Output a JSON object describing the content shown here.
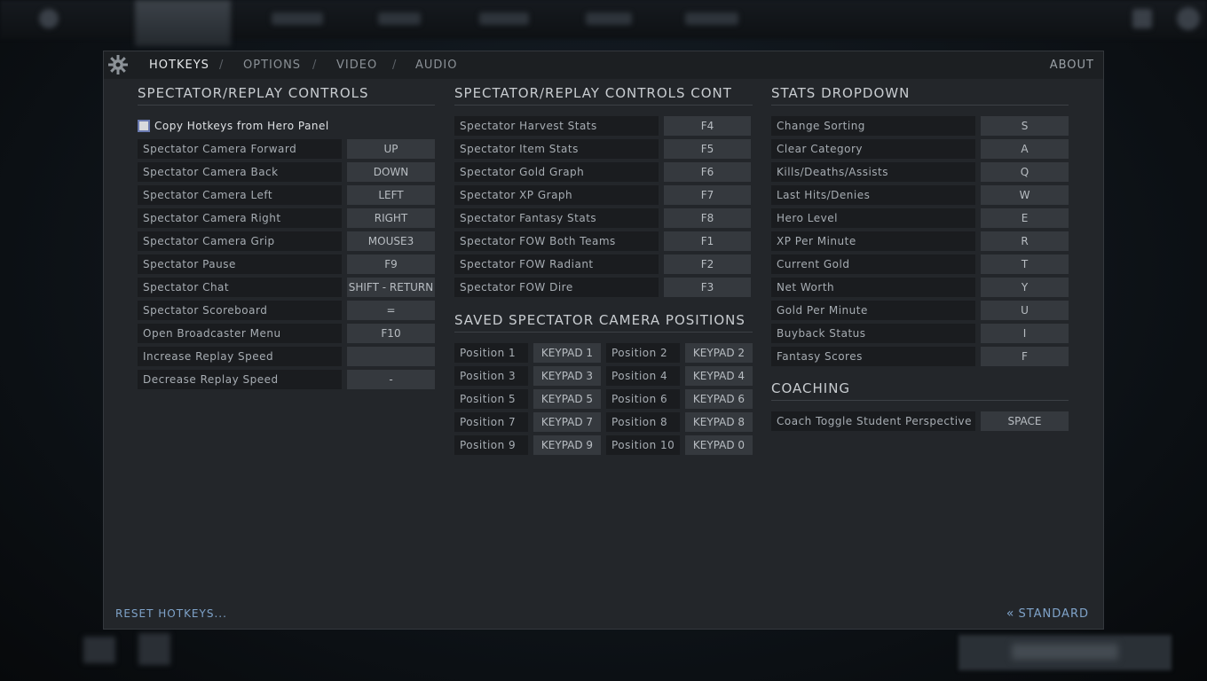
{
  "tabs": {
    "hotkeys": "HOTKEYS",
    "options": "OPTIONS",
    "video": "VIDEO",
    "audio": "AUDIO",
    "separator": "/",
    "about": "ABOUT"
  },
  "col1": {
    "title": "SPECTATOR/REPLAY CONTROLS",
    "checkbox_label": "Copy Hotkeys from Hero Panel",
    "rows": [
      {
        "label": "Spectator Camera Forward",
        "key": "UP"
      },
      {
        "label": "Spectator Camera Back",
        "key": "DOWN"
      },
      {
        "label": "Spectator Camera Left",
        "key": "LEFT"
      },
      {
        "label": "Spectator Camera Right",
        "key": "RIGHT"
      },
      {
        "label": "Spectator Camera Grip",
        "key": "MOUSE3"
      },
      {
        "label": "Spectator Pause",
        "key": "F9"
      },
      {
        "label": "Spectator Chat",
        "key": "SHIFT - RETURN"
      },
      {
        "label": "Spectator Scoreboard",
        "key": "="
      },
      {
        "label": "Open Broadcaster Menu",
        "key": "F10"
      },
      {
        "label": "Increase Replay Speed",
        "key": ""
      },
      {
        "label": "Decrease Replay Speed",
        "key": "-"
      }
    ]
  },
  "col2": {
    "title": "SPECTATOR/REPLAY CONTROLS CONT",
    "rows": [
      {
        "label": "Spectator Harvest Stats",
        "key": "F4"
      },
      {
        "label": "Spectator Item Stats",
        "key": "F5"
      },
      {
        "label": "Spectator Gold Graph",
        "key": "F6"
      },
      {
        "label": "Spectator XP Graph",
        "key": "F7"
      },
      {
        "label": "Spectator Fantasy Stats",
        "key": "F8"
      },
      {
        "label": "Spectator FOW Both Teams",
        "key": "F1"
      },
      {
        "label": "Spectator FOW Radiant",
        "key": "F2"
      },
      {
        "label": "Spectator FOW Dire",
        "key": "F3"
      }
    ],
    "positions_title": "SAVED SPECTATOR CAMERA POSITIONS",
    "positions": [
      [
        {
          "label": "Position 1",
          "key": "KEYPAD 1"
        },
        {
          "label": "Position 2",
          "key": "KEYPAD 2"
        }
      ],
      [
        {
          "label": "Position 3",
          "key": "KEYPAD 3"
        },
        {
          "label": "Position 4",
          "key": "KEYPAD 4"
        }
      ],
      [
        {
          "label": "Position 5",
          "key": "KEYPAD 5"
        },
        {
          "label": "Position 6",
          "key": "KEYPAD 6"
        }
      ],
      [
        {
          "label": "Position 7",
          "key": "KEYPAD 7"
        },
        {
          "label": "Position 8",
          "key": "KEYPAD 8"
        }
      ],
      [
        {
          "label": "Position 9",
          "key": "KEYPAD 9"
        },
        {
          "label": "Position 10",
          "key": "KEYPAD 0"
        }
      ]
    ]
  },
  "col3": {
    "title": "STATS DROPDOWN",
    "rows": [
      {
        "label": "Change Sorting",
        "key": "S"
      },
      {
        "label": "Clear Category",
        "key": "A"
      },
      {
        "label": "Kills/Deaths/Assists",
        "key": "Q"
      },
      {
        "label": "Last Hits/Denies",
        "key": "W"
      },
      {
        "label": "Hero Level",
        "key": "E"
      },
      {
        "label": "XP Per Minute",
        "key": "R"
      },
      {
        "label": "Current Gold",
        "key": "T"
      },
      {
        "label": "Net Worth",
        "key": "Y"
      },
      {
        "label": "Gold Per Minute",
        "key": "U"
      },
      {
        "label": "Buyback Status",
        "key": "I"
      },
      {
        "label": "Fantasy Scores",
        "key": "F"
      }
    ],
    "coaching_title": "COACHING",
    "coaching_rows": [
      {
        "label": "Coach Toggle Student Perspective",
        "key": "SPACE"
      }
    ]
  },
  "footer": {
    "reset": "RESET HOTKEYS...",
    "standard_icon": "«",
    "standard": "STANDARD"
  }
}
